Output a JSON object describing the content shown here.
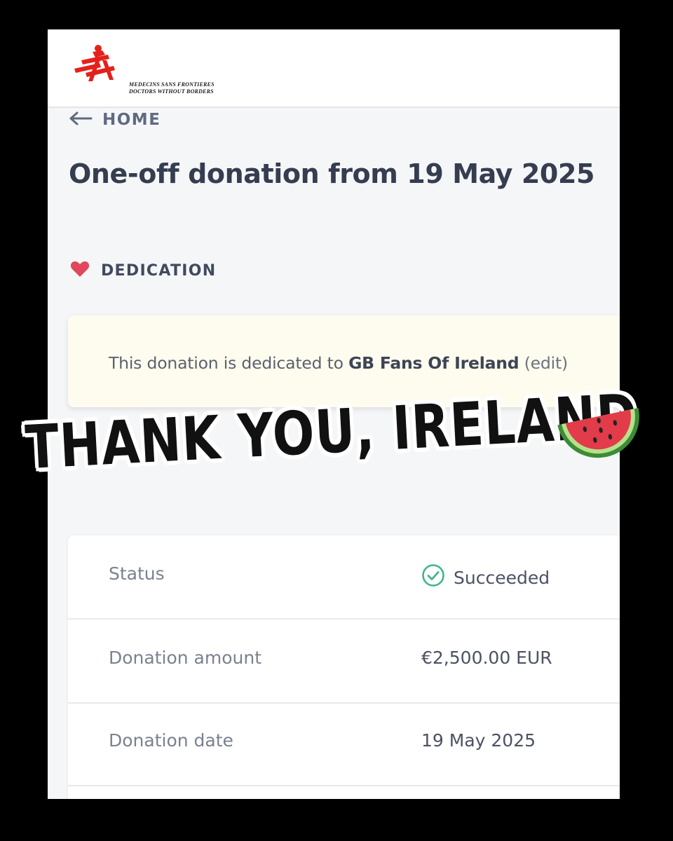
{
  "header": {
    "logo": {
      "line1": "MEDECINS SANS FRONTIERES",
      "line2": "DOCTORS WITHOUT BORDERS",
      "brand_color": "#e4211b"
    }
  },
  "nav": {
    "back_label": "HOME",
    "back_icon": "arrow-left-icon"
  },
  "page": {
    "title": "One-off donation from 19 May 2025"
  },
  "dedication": {
    "section_label": "DEDICATION",
    "icon": "heart-icon",
    "icon_color": "#e0485d",
    "text_prefix": "This donation is dedicated to ",
    "name": "GB Fans Of Ireland",
    "edit_label": "(edit)"
  },
  "details": {
    "rows": [
      {
        "label": "Status",
        "value": "Succeeded",
        "icon": "check-circle-icon",
        "icon_color": "#3fb58f"
      },
      {
        "label": "Donation amount",
        "value": "€2,500.00 EUR"
      },
      {
        "label": "Donation date",
        "value": "19 May 2025"
      }
    ]
  },
  "overlay": {
    "caption": "THANK YOU, IRELAND",
    "emoji": "watermelon-icon"
  }
}
